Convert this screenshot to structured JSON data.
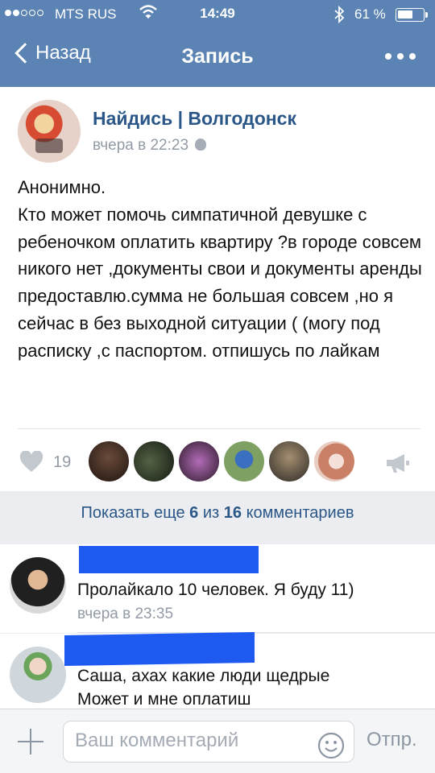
{
  "status_bar": {
    "carrier": "MTS RUS",
    "time": "14:49",
    "battery_text": "61 %",
    "battery_level": 0.61
  },
  "nav": {
    "back_label": "Назад",
    "title": "Запись"
  },
  "post": {
    "author": "Найдись | Волгодонск",
    "date": "вчера в 22:23",
    "text": "Анонимно.\nКто может помочь симпатичной девушке с ребеночком оплатить квартиру ?в городе совсем никого нет ,документы свои и документы аренды предоставлю.сумма не большая совсем ,но я сейчас в без выходной ситуации ( (могу под расписку ,с паспортом. отпишусь по лайкам",
    "likes": "19"
  },
  "show_more": {
    "prefix": "Показать еще",
    "shown": "6",
    "middle": "из",
    "total": "16",
    "suffix": "комментариев"
  },
  "comments": [
    {
      "text": "Пролайкало 10 человек. Я буду 11)",
      "date": "вчера в 23:35"
    },
    {
      "text": "Саша, ахах какие люди щедрые\nМожет и мне оплатиш"
    }
  ],
  "composer": {
    "placeholder": "Ваш комментарий",
    "send_label": "Отпр."
  },
  "colors": {
    "header": "#5b83b3",
    "link": "#2b5788",
    "muted": "#939ba6",
    "redaction": "#1e5af0"
  }
}
